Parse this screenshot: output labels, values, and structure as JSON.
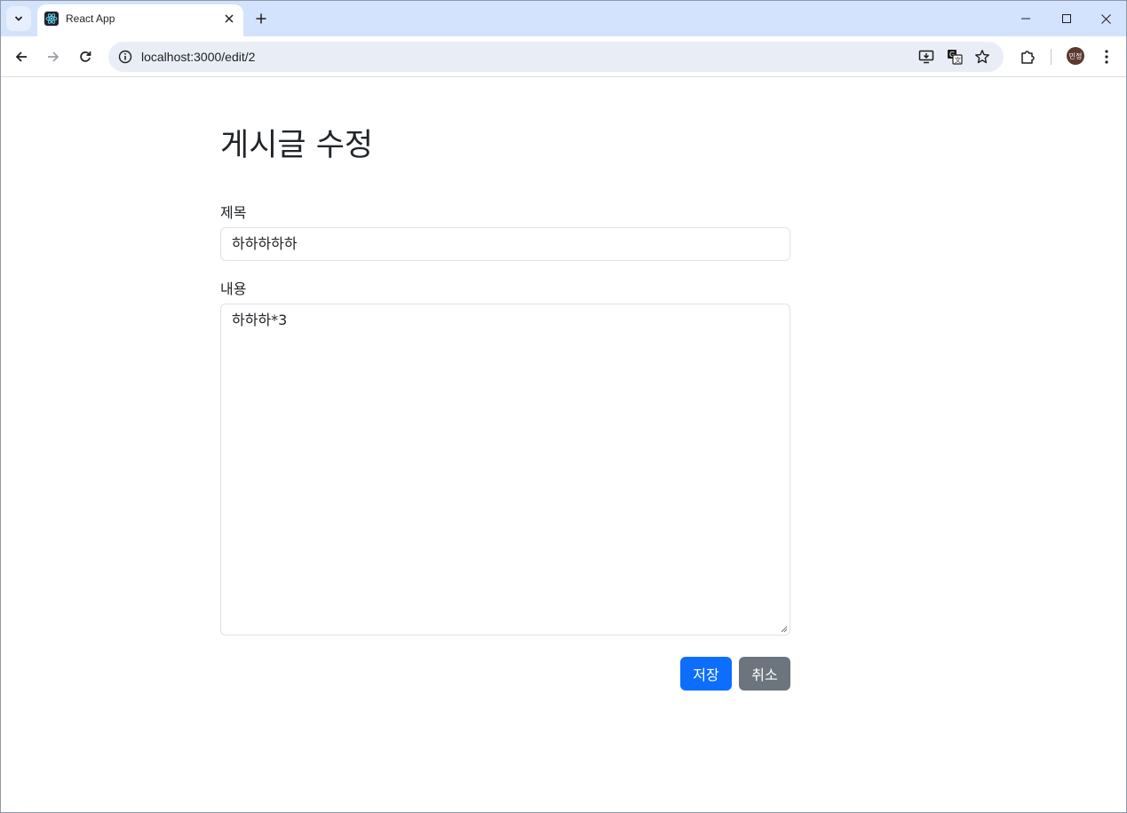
{
  "browser": {
    "tab": {
      "title": "React App"
    },
    "address_bar": {
      "url": "localhost:3000/edit/2"
    },
    "profile": {
      "initials": "민정"
    }
  },
  "page": {
    "title": "게시글 수정",
    "form": {
      "title_label": "제목",
      "title_value": "하하하하하",
      "content_label": "내용",
      "content_value": "하하하*3",
      "save_label": "저장",
      "cancel_label": "취소"
    }
  },
  "colors": {
    "tabstrip": "#d3e3fd",
    "primary": "#0d6efd",
    "secondary": "#6c757d",
    "text": "#212529"
  }
}
